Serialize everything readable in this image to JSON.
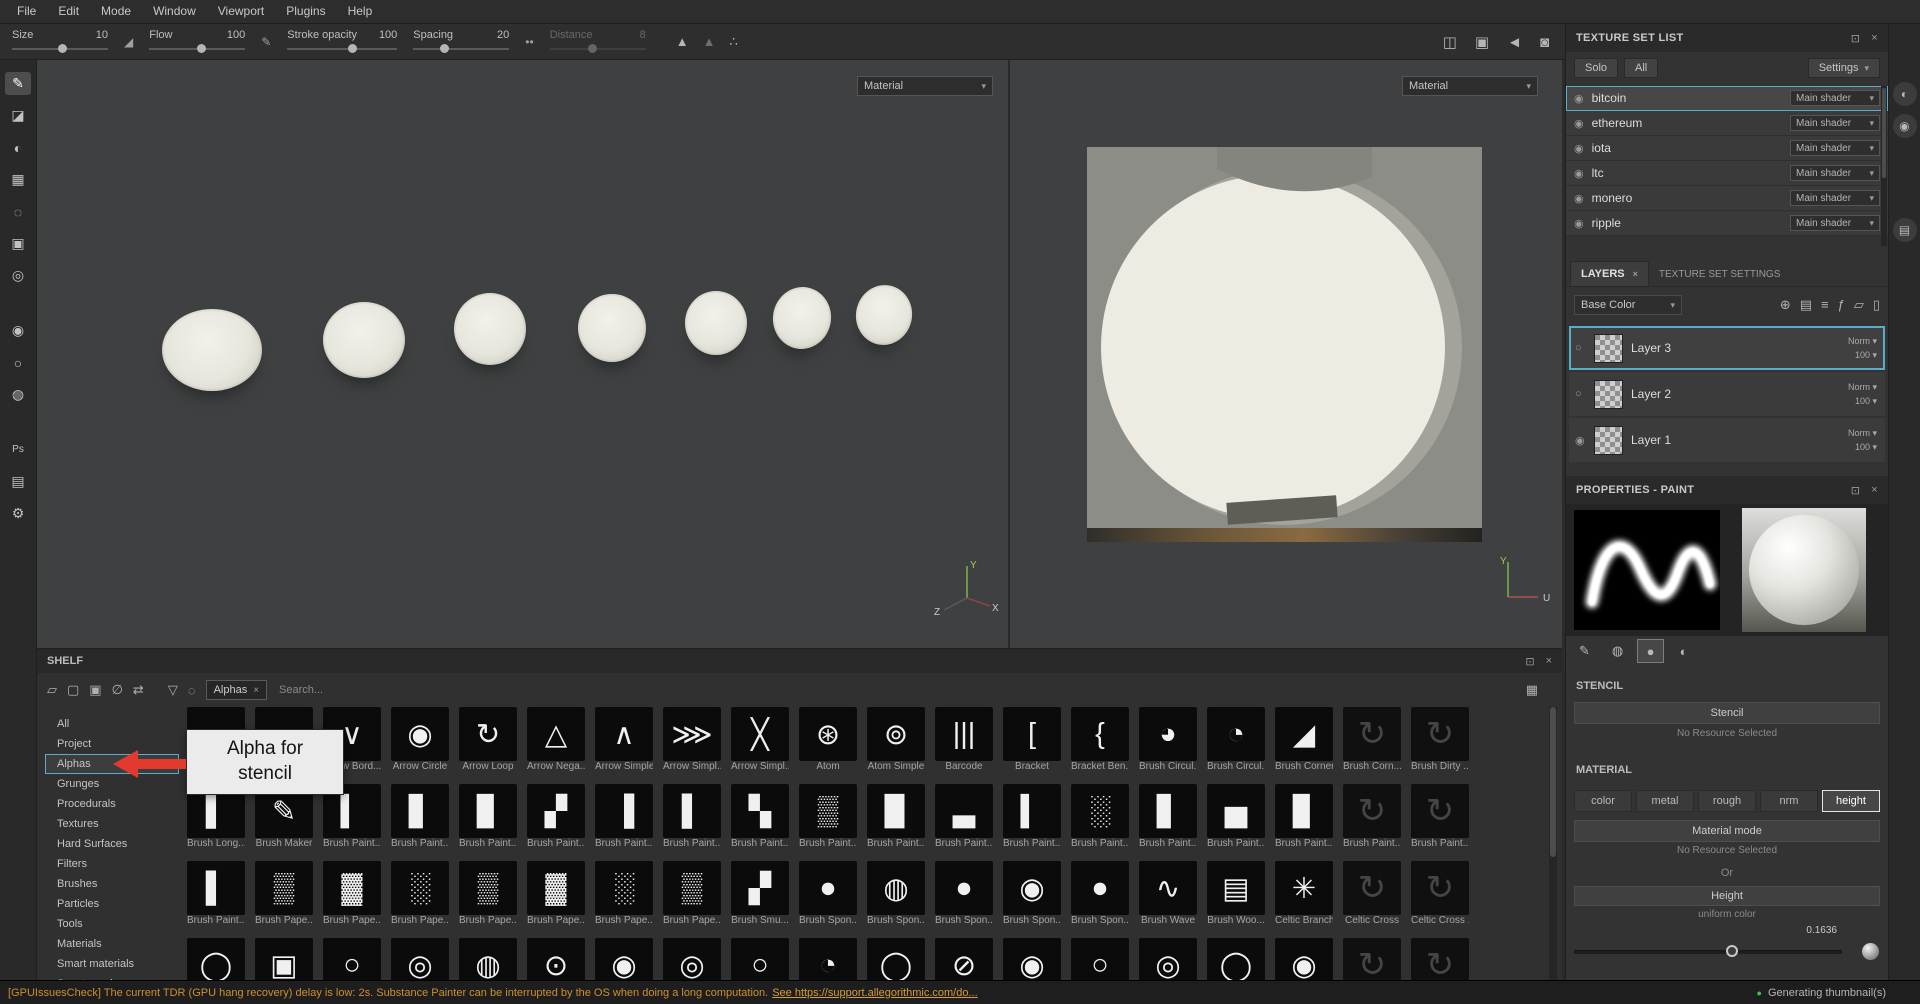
{
  "app": {
    "accent": "#56aecb",
    "icons": {
      "chevron_down": "▾",
      "close": "×",
      "popout": "⊡",
      "radio_on": "◉",
      "radio_off": "○",
      "grid_view": "▦",
      "green_dot": "●",
      "funnel": "▽",
      "link": "◌"
    }
  },
  "menu": {
    "items": [
      "File",
      "Edit",
      "Mode",
      "Window",
      "Viewport",
      "Plugins",
      "Help"
    ]
  },
  "toolbar": {
    "groups": [
      {
        "label": "Size",
        "value": "10"
      },
      {
        "label": "Flow",
        "value": "100"
      },
      {
        "label": "Stroke opacity",
        "value": "100"
      },
      {
        "label": "Spacing",
        "value": "20"
      },
      {
        "label": "Distance",
        "value": "8"
      }
    ],
    "falloff_icon": "◢",
    "pencil_icon": "✎",
    "dot_icon": "••",
    "symmetry_icons": [
      {
        "name": "falloff-curve-a-icon",
        "glyph": "▲",
        "dim": false
      },
      {
        "name": "falloff-curve-b-icon",
        "glyph": "▲",
        "dim": true
      },
      {
        "name": "symmetry-icon",
        "glyph": "∴",
        "dim": false
      }
    ],
    "right_icons": [
      {
        "name": "perspective-toggle-icon",
        "glyph": "◫"
      },
      {
        "name": "render-mode-icon",
        "glyph": "▣"
      },
      {
        "name": "camera-mode-icon",
        "glyph": "◄"
      },
      {
        "name": "screenshot-icon",
        "glyph": "◙"
      }
    ]
  },
  "left_tools": [
    {
      "name": "paint-tool",
      "glyph": "✎",
      "active": true
    },
    {
      "name": "eraser-tool",
      "glyph": "◪",
      "active": false
    },
    {
      "name": "projection-tool",
      "glyph": "◐",
      "active": false
    },
    {
      "name": "polygon-fill-tool",
      "glyph": "▦",
      "active": false
    },
    {
      "name": "smudge-tool",
      "glyph": "◌",
      "active": false
    },
    {
      "name": "clone-tool",
      "glyph": "▣",
      "active": false
    },
    {
      "name": "material-picker-tool",
      "glyph": "◎",
      "active": false
    },
    {
      "name": "resources-tool",
      "glyph": "◉",
      "active": false
    },
    {
      "name": "light-tool",
      "glyph": "○",
      "active": false
    },
    {
      "name": "display-tool",
      "glyph": "◍",
      "active": false
    },
    {
      "name": "photoshop-plugin-icon",
      "glyph": "Ps",
      "active": false
    },
    {
      "name": "export-plugin-icon",
      "glyph": "▤",
      "active": false
    },
    {
      "name": "plugin-settings-icon",
      "glyph": "⚙",
      "active": false
    }
  ],
  "viewport3d": {
    "material_dropdown": "Material",
    "axis": {
      "x": "X",
      "y": "Y",
      "z": "Z"
    }
  },
  "viewport2d": {
    "material_dropdown": "Material",
    "axis": {
      "y": "Y",
      "u": "U"
    }
  },
  "texture_set_list": {
    "title": "TEXTURE SET LIST",
    "solo_button": "Solo",
    "all_button": "All",
    "settings_button": "Settings",
    "shader_button": "Main shader",
    "items": [
      {
        "name": "bitcoin",
        "selected": true
      },
      {
        "name": "ethereum",
        "selected": false
      },
      {
        "name": "iota",
        "selected": false
      },
      {
        "name": "ltc",
        "selected": false
      },
      {
        "name": "monero",
        "selected": false
      },
      {
        "name": "ripple",
        "selected": false
      }
    ]
  },
  "layers_panel": {
    "tab_layers": "LAYERS",
    "tab_settings": "TEXTURE SET SETTINGS",
    "channel_dropdown": "Base Color",
    "action_icons": [
      {
        "name": "add-mask-icon",
        "glyph": "⊕"
      },
      {
        "name": "add-fill-layer-icon",
        "glyph": "▤"
      },
      {
        "name": "add-layer-icon",
        "glyph": "≡"
      },
      {
        "name": "add-effect-icon",
        "glyph": "ƒ"
      },
      {
        "name": "add-folder-icon",
        "glyph": "▱"
      },
      {
        "name": "delete-layer-icon",
        "glyph": "▯"
      }
    ],
    "layers": [
      {
        "name": "Layer 3",
        "blend": "Norm",
        "opacity": "100",
        "selected": true,
        "radio_on": false
      },
      {
        "name": "Layer 2",
        "blend": "Norm",
        "opacity": "100",
        "selected": false,
        "radio_on": false
      },
      {
        "name": "Layer 1",
        "blend": "Norm",
        "opacity": "100",
        "selected": false,
        "radio_on": true
      }
    ]
  },
  "properties": {
    "title": "PROPERTIES - PAINT",
    "preview_tabs": [
      {
        "name": "brush-properties-icon",
        "glyph": "✎",
        "selected": false
      },
      {
        "name": "alpha-properties-icon",
        "glyph": "◍",
        "selected": false
      },
      {
        "name": "stencil-properties-icon",
        "glyph": "●",
        "selected": true
      },
      {
        "name": "material-properties-icon",
        "glyph": "◐",
        "selected": false
      }
    ],
    "stencil": {
      "title": "STENCIL",
      "button": "Stencil",
      "status": "No Resource Selected"
    },
    "material": {
      "title": "MATERIAL",
      "channels": [
        "color",
        "metal",
        "rough",
        "nrm",
        "height"
      ],
      "selected_channel": "height",
      "mode_button": "Material mode",
      "mode_status": "No Resource Selected",
      "or_label": "Or",
      "height_button": "Height",
      "height_sub": "uniform color",
      "height_value": "0.1636"
    }
  },
  "far_strip": {
    "icons": [
      {
        "name": "display-settings-icon",
        "glyph": "◐"
      },
      {
        "name": "camera-settings-icon",
        "glyph": "◉"
      },
      {
        "name": "log-icon",
        "glyph": "▤"
      }
    ]
  },
  "shelf": {
    "title": "SHELF",
    "toolbar_icons": [
      {
        "name": "folder-icon",
        "glyph": "▱"
      },
      {
        "name": "new-resource-icon",
        "glyph": "▢"
      },
      {
        "name": "duplicate-icon",
        "glyph": "▣"
      },
      {
        "name": "hide-resources-icon",
        "glyph": "∅"
      },
      {
        "name": "import-resources-icon",
        "glyph": "⇄"
      }
    ],
    "chip": "Alphas",
    "search_placeholder": "Search...",
    "categories": [
      "All",
      "Project",
      "Alphas",
      "Grunges",
      "Procedurals",
      "Textures",
      "Hard Surfaces",
      "Filters",
      "Brushes",
      "Particles",
      "Tools",
      "Materials",
      "Smart materials",
      "Smart masks"
    ],
    "selected_category": "Alphas",
    "annotation": "Alpha for stencil",
    "rows": [
      [
        {
          "label": "",
          "glyph": "",
          "faded": false
        },
        {
          "label": "",
          "glyph": "",
          "faded": false
        },
        {
          "label": "Arrow Bord...",
          "glyph": "∨",
          "faded": false
        },
        {
          "label": "Arrow Circle",
          "glyph": "◉",
          "faded": false
        },
        {
          "label": "Arrow Loop",
          "glyph": "↻",
          "faded": false
        },
        {
          "label": "Arrow Nega...",
          "glyph": "△",
          "faded": false
        },
        {
          "label": "Arrow Simple",
          "glyph": "∧",
          "faded": false
        },
        {
          "label": "Arrow Simpl...",
          "glyph": "⋙",
          "faded": false
        },
        {
          "label": "Arrow Simpl...",
          "glyph": "╳",
          "faded": false
        },
        {
          "label": "Atom",
          "glyph": "⊛",
          "faded": false
        },
        {
          "label": "Atom Simple",
          "glyph": "⊚",
          "faded": false
        },
        {
          "label": "Barcode",
          "glyph": "|||",
          "faded": false
        },
        {
          "label": "Bracket",
          "glyph": "[",
          "faded": false
        },
        {
          "label": "Bracket Ben...",
          "glyph": "{",
          "faded": false
        },
        {
          "label": "Brush Circul...",
          "glyph": "◕",
          "faded": false
        },
        {
          "label": "Brush Circul...",
          "glyph": "◔",
          "faded": false
        },
        {
          "label": "Brush Corner",
          "glyph": "◢",
          "faded": false
        },
        {
          "label": "Brush Corn...",
          "glyph": "↻",
          "faded": true
        },
        {
          "label": "Brush Dirty ...",
          "glyph": "↻",
          "faded": true
        }
      ],
      [
        {
          "label": "Brush Long...",
          "glyph": "▌",
          "faded": false
        },
        {
          "label": "Brush Maker",
          "glyph": "✎",
          "faded": false
        },
        {
          "label": "Brush Paint...",
          "glyph": "▍",
          "faded": false
        },
        {
          "label": "Brush Paint...",
          "glyph": "▋",
          "faded": false
        },
        {
          "label": "Brush Paint...",
          "glyph": "▊",
          "faded": false
        },
        {
          "label": "Brush Paint...",
          "glyph": "▞",
          "faded": false
        },
        {
          "label": "Brush Paint...",
          "glyph": "▐",
          "faded": false
        },
        {
          "label": "Brush Paint...",
          "glyph": "▌",
          "faded": false
        },
        {
          "label": "Brush Paint...",
          "glyph": "▚",
          "faded": false
        },
        {
          "label": "Brush Paint...",
          "glyph": "▒",
          "faded": false
        },
        {
          "label": "Brush Paint...",
          "glyph": "▉",
          "faded": false
        },
        {
          "label": "Brush Paint...",
          "glyph": "▃",
          "faded": false
        },
        {
          "label": "Brush Paint...",
          "glyph": "▍",
          "faded": false
        },
        {
          "label": "Brush Paint...",
          "glyph": "░",
          "faded": false
        },
        {
          "label": "Brush Paint...",
          "glyph": "▋",
          "faded": false
        },
        {
          "label": "Brush Paint...",
          "glyph": "▅",
          "faded": false
        },
        {
          "label": "Brush Paint...",
          "glyph": "▊",
          "faded": false
        },
        {
          "label": "Brush Paint...",
          "glyph": "↻",
          "faded": true
        },
        {
          "label": "Brush Paint...",
          "glyph": "↻",
          "faded": true
        }
      ],
      [
        {
          "label": "Brush Paint...",
          "glyph": "▌",
          "faded": false
        },
        {
          "label": "Brush Pape...",
          "glyph": "▒",
          "faded": false
        },
        {
          "label": "Brush Pape...",
          "glyph": "▓",
          "faded": false
        },
        {
          "label": "Brush Pape...",
          "glyph": "░",
          "faded": false
        },
        {
          "label": "Brush Pape...",
          "glyph": "▒",
          "faded": false
        },
        {
          "label": "Brush Pape...",
          "glyph": "▓",
          "faded": false
        },
        {
          "label": "Brush Pape...",
          "glyph": "░",
          "faded": false
        },
        {
          "label": "Brush Pape...",
          "glyph": "▒",
          "faded": false
        },
        {
          "label": "Brush Smu...",
          "glyph": "▞",
          "faded": false
        },
        {
          "label": "Brush Spon...",
          "glyph": "●",
          "faded": false
        },
        {
          "label": "Brush Spon...",
          "glyph": "◍",
          "faded": false
        },
        {
          "label": "Brush Spon...",
          "glyph": "●",
          "faded": false
        },
        {
          "label": "Brush Spon...",
          "glyph": "◉",
          "faded": false
        },
        {
          "label": "Brush Spon...",
          "glyph": "●",
          "faded": false
        },
        {
          "label": "Brush Wave",
          "glyph": "∿",
          "faded": false
        },
        {
          "label": "Brush Woo...",
          "glyph": "▤",
          "faded": false
        },
        {
          "label": "Celtic Branch",
          "glyph": "✳",
          "faded": false
        },
        {
          "label": "Celtic Cross",
          "glyph": "↻",
          "faded": true
        },
        {
          "label": "Celtic Cross ...",
          "glyph": "↻",
          "faded": true
        }
      ],
      [
        {
          "label": "",
          "glyph": "◯",
          "faded": false
        },
        {
          "label": "",
          "glyph": "▣",
          "faded": false
        },
        {
          "label": "",
          "glyph": "○",
          "faded": false
        },
        {
          "label": "",
          "glyph": "◎",
          "faded": false
        },
        {
          "label": "",
          "glyph": "◍",
          "faded": false
        },
        {
          "label": "",
          "glyph": "⊙",
          "faded": false
        },
        {
          "label": "",
          "glyph": "◉",
          "faded": false
        },
        {
          "label": "",
          "glyph": "◎",
          "faded": false
        },
        {
          "label": "",
          "glyph": "○",
          "faded": false
        },
        {
          "label": "",
          "glyph": "◔",
          "faded": false
        },
        {
          "label": "",
          "glyph": "◯",
          "faded": false
        },
        {
          "label": "",
          "glyph": "⊘",
          "faded": false
        },
        {
          "label": "",
          "glyph": "◉",
          "faded": false
        },
        {
          "label": "",
          "glyph": "○",
          "faded": false
        },
        {
          "label": "",
          "glyph": "◎",
          "faded": false
        },
        {
          "label": "",
          "glyph": "◯",
          "faded": false
        },
        {
          "label": "",
          "glyph": "◉",
          "faded": false
        },
        {
          "label": "",
          "glyph": "↻",
          "faded": true
        },
        {
          "label": "",
          "glyph": "↻",
          "faded": true
        }
      ]
    ]
  },
  "status_bar": {
    "message_prefix": "[GPUIssuesCheck] The current TDR (GPU hang recovery) delay is low: 2s. Substance Painter can be interrupted by the OS when doing a long computation.",
    "message_link": "See https://support.allegorithmic.com/do...",
    "right_status": "Generating thumbnail(s)"
  }
}
